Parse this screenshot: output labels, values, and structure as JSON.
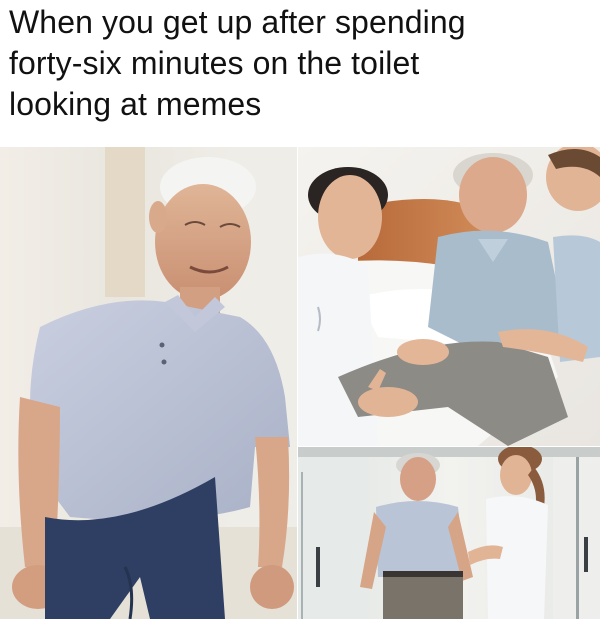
{
  "caption": {
    "lines": [
      "When you get up after spending",
      "forty-six minutes on the toilet",
      "looking at memes"
    ]
  },
  "collage": {
    "panels": [
      {
        "name": "older-man-standing-up",
        "icon": "photo-icon"
      },
      {
        "name": "nurses-helping-man-from-bed",
        "icon": "photo-icon"
      },
      {
        "name": "nurse-supporting-man-walking",
        "icon": "photo-icon"
      }
    ]
  }
}
